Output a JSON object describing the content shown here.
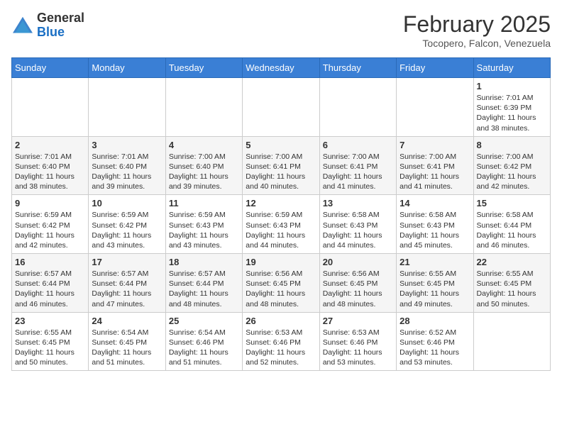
{
  "header": {
    "logo_general": "General",
    "logo_blue": "Blue",
    "month_title": "February 2025",
    "location": "Tocopero, Falcon, Venezuela"
  },
  "days_of_week": [
    "Sunday",
    "Monday",
    "Tuesday",
    "Wednesday",
    "Thursday",
    "Friday",
    "Saturday"
  ],
  "weeks": [
    [
      {
        "day": "",
        "info": ""
      },
      {
        "day": "",
        "info": ""
      },
      {
        "day": "",
        "info": ""
      },
      {
        "day": "",
        "info": ""
      },
      {
        "day": "",
        "info": ""
      },
      {
        "day": "",
        "info": ""
      },
      {
        "day": "1",
        "info": "Sunrise: 7:01 AM\nSunset: 6:39 PM\nDaylight: 11 hours and 38 minutes."
      }
    ],
    [
      {
        "day": "2",
        "info": "Sunrise: 7:01 AM\nSunset: 6:40 PM\nDaylight: 11 hours and 38 minutes."
      },
      {
        "day": "3",
        "info": "Sunrise: 7:01 AM\nSunset: 6:40 PM\nDaylight: 11 hours and 39 minutes."
      },
      {
        "day": "4",
        "info": "Sunrise: 7:00 AM\nSunset: 6:40 PM\nDaylight: 11 hours and 39 minutes."
      },
      {
        "day": "5",
        "info": "Sunrise: 7:00 AM\nSunset: 6:41 PM\nDaylight: 11 hours and 40 minutes."
      },
      {
        "day": "6",
        "info": "Sunrise: 7:00 AM\nSunset: 6:41 PM\nDaylight: 11 hours and 41 minutes."
      },
      {
        "day": "7",
        "info": "Sunrise: 7:00 AM\nSunset: 6:41 PM\nDaylight: 11 hours and 41 minutes."
      },
      {
        "day": "8",
        "info": "Sunrise: 7:00 AM\nSunset: 6:42 PM\nDaylight: 11 hours and 42 minutes."
      }
    ],
    [
      {
        "day": "9",
        "info": "Sunrise: 6:59 AM\nSunset: 6:42 PM\nDaylight: 11 hours and 42 minutes."
      },
      {
        "day": "10",
        "info": "Sunrise: 6:59 AM\nSunset: 6:42 PM\nDaylight: 11 hours and 43 minutes."
      },
      {
        "day": "11",
        "info": "Sunrise: 6:59 AM\nSunset: 6:43 PM\nDaylight: 11 hours and 43 minutes."
      },
      {
        "day": "12",
        "info": "Sunrise: 6:59 AM\nSunset: 6:43 PM\nDaylight: 11 hours and 44 minutes."
      },
      {
        "day": "13",
        "info": "Sunrise: 6:58 AM\nSunset: 6:43 PM\nDaylight: 11 hours and 44 minutes."
      },
      {
        "day": "14",
        "info": "Sunrise: 6:58 AM\nSunset: 6:43 PM\nDaylight: 11 hours and 45 minutes."
      },
      {
        "day": "15",
        "info": "Sunrise: 6:58 AM\nSunset: 6:44 PM\nDaylight: 11 hours and 46 minutes."
      }
    ],
    [
      {
        "day": "16",
        "info": "Sunrise: 6:57 AM\nSunset: 6:44 PM\nDaylight: 11 hours and 46 minutes."
      },
      {
        "day": "17",
        "info": "Sunrise: 6:57 AM\nSunset: 6:44 PM\nDaylight: 11 hours and 47 minutes."
      },
      {
        "day": "18",
        "info": "Sunrise: 6:57 AM\nSunset: 6:44 PM\nDaylight: 11 hours and 48 minutes."
      },
      {
        "day": "19",
        "info": "Sunrise: 6:56 AM\nSunset: 6:45 PM\nDaylight: 11 hours and 48 minutes."
      },
      {
        "day": "20",
        "info": "Sunrise: 6:56 AM\nSunset: 6:45 PM\nDaylight: 11 hours and 48 minutes."
      },
      {
        "day": "21",
        "info": "Sunrise: 6:55 AM\nSunset: 6:45 PM\nDaylight: 11 hours and 49 minutes."
      },
      {
        "day": "22",
        "info": "Sunrise: 6:55 AM\nSunset: 6:45 PM\nDaylight: 11 hours and 50 minutes."
      }
    ],
    [
      {
        "day": "23",
        "info": "Sunrise: 6:55 AM\nSunset: 6:45 PM\nDaylight: 11 hours and 50 minutes."
      },
      {
        "day": "24",
        "info": "Sunrise: 6:54 AM\nSunset: 6:45 PM\nDaylight: 11 hours and 51 minutes."
      },
      {
        "day": "25",
        "info": "Sunrise: 6:54 AM\nSunset: 6:46 PM\nDaylight: 11 hours and 51 minutes."
      },
      {
        "day": "26",
        "info": "Sunrise: 6:53 AM\nSunset: 6:46 PM\nDaylight: 11 hours and 52 minutes."
      },
      {
        "day": "27",
        "info": "Sunrise: 6:53 AM\nSunset: 6:46 PM\nDaylight: 11 hours and 53 minutes."
      },
      {
        "day": "28",
        "info": "Sunrise: 6:52 AM\nSunset: 6:46 PM\nDaylight: 11 hours and 53 minutes."
      },
      {
        "day": "",
        "info": ""
      }
    ]
  ]
}
